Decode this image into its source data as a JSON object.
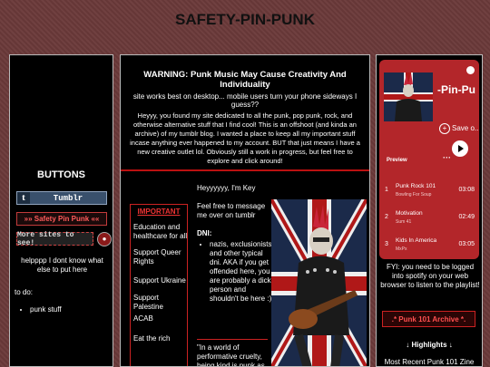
{
  "site": {
    "title": "SAFETY-PIN-PUNK"
  },
  "left": {
    "buttons_heading": "BUTTONS",
    "tumblr_badge": {
      "icon_letter": "t",
      "label": "Tumblr"
    },
    "spp_badge": "»» Safety Pin Punk ««",
    "more_badge": "More sites to see!",
    "help_text": "helpppp I dont know what else to put here",
    "todo_label": "to do:",
    "todo_items": [
      "punk stuff"
    ]
  },
  "middle": {
    "warning_title": "WARNING: Punk Music May Cause Creativity And Individuality",
    "warning_sub": "site works best on desktop... mobile users turn your phone sideways I guess??",
    "intro": "Heyyy, you found my site dedicated to all the punk, pop punk, rock, and otherwise alternative stuff that I find cool! This is an offshoot (and kinda an archive) of my tumblr blog. I wanted a place to keep all my important stuff incase anything ever happened to my account. BUT that just means I have a new creative outlet lol. Obviously still a work in progress, but feel free to explore and click around!",
    "important": {
      "heading": "IMPORTANT",
      "items": [
        "Education and healthcare for all",
        "Support Queer Rights",
        "Support Ukraine",
        "Support Palestine",
        "ACAB",
        "Eat the rich"
      ]
    },
    "greeting": "Heyyyyyy, I'm Key",
    "message_note": "Feel free to message me over on tumblr",
    "dni_label": "DNI:",
    "dni_items": [
      "nazis, exclusionists, and other typical dni. AKA if you get offended here, you are probably a dick person and shouldn't be here :)"
    ],
    "quote": "\"In a world of performative cruelty, being kind is punk as"
  },
  "right": {
    "spotify": {
      "playlist_title": "-Pin-Pu",
      "save_label": "Save o...",
      "preview_label": "Preview",
      "more_label": "···",
      "tracks": [
        {
          "num": "1",
          "name": "Punk Rock 101",
          "artist": "Bowling For Soup",
          "duration": "03:08"
        },
        {
          "num": "2",
          "name": "Motivation",
          "artist": "Sum 41",
          "duration": "02:49"
        },
        {
          "num": "3",
          "name": "Kids In America",
          "artist": "MxPx",
          "duration": "03:05"
        }
      ]
    },
    "fyi": "FYI: you need to be logged into spotify on your web browser to listen to the playlist!",
    "archive_button": ".* Punk 101 Archive *.",
    "highlights": "↓ Highlights ↓",
    "zine": "Most Recent Punk 101 Zine"
  }
}
